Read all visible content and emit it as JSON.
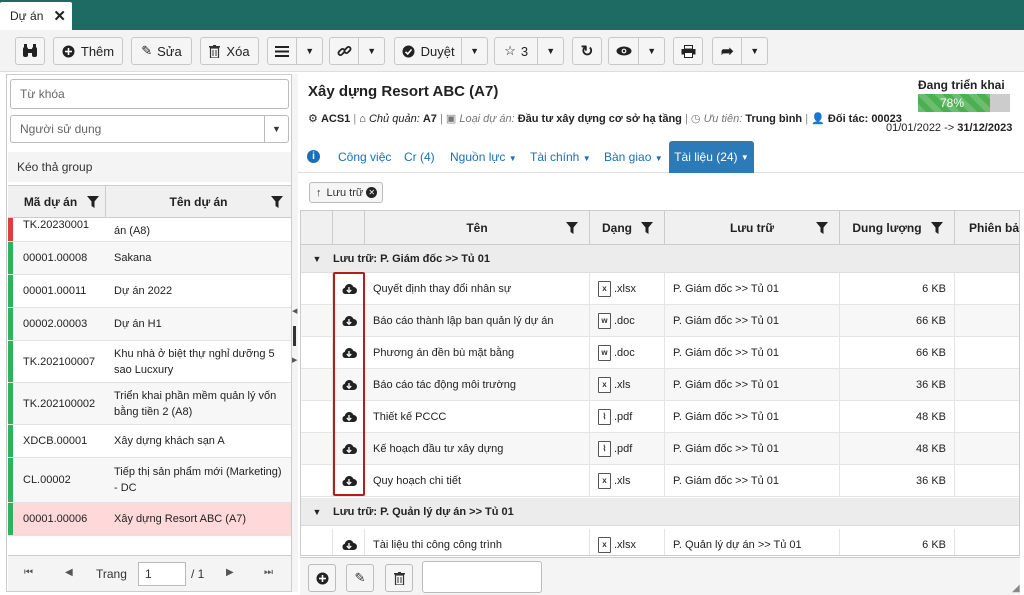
{
  "tab": {
    "label": "Dự án",
    "close": "✕"
  },
  "toolbar": {
    "add_label": "Thêm",
    "edit_label": "Sửa",
    "delete_label": "Xóa",
    "approve_label": "Duyệt",
    "star_count": "3"
  },
  "left": {
    "keyword_placeholder": "Từ khóa",
    "user_placeholder": "Người sử dụng",
    "group_hint": "Kéo thả group",
    "col_code": "Mã dự án",
    "col_name": "Tên dự án",
    "rows": [
      {
        "code": "TK.20230001",
        "name": "án (A8)",
        "status_color": "#e03c3c"
      },
      {
        "code": "00001.00008",
        "name": "Sakana",
        "status_color": "#2db35e"
      },
      {
        "code": "00001.00011",
        "name": "Dự án 2022",
        "status_color": "#2db35e"
      },
      {
        "code": "00002.00003",
        "name": "Dự án H1",
        "status_color": "#2db35e"
      },
      {
        "code": "TK.202100007",
        "name": "Khu nhà ở biệt thự nghỉ dưỡng 5 sao Lucxury",
        "status_color": "#2db35e"
      },
      {
        "code": "TK.202100002",
        "name": "Triển khai phần mềm quản lý vốn bằng tiền 2 (A8)",
        "status_color": "#2db35e"
      },
      {
        "code": "XDCB.00001",
        "name": "Xây dựng khách sạn A",
        "status_color": "#2db35e"
      },
      {
        "code": "CL.00002",
        "name": "Tiếp thị sản phẩm mới (Marketing) - DC",
        "status_color": "#2db35e"
      },
      {
        "code": "00001.00006",
        "name": "Xây dựng Resort ABC (A7)",
        "status_color": "#2db35e"
      }
    ],
    "pager_label": "Trang",
    "page_value": "1",
    "page_total": "/ 1"
  },
  "project": {
    "title": "Xây dựng Resort ABC (A7)",
    "status": "Đang triển khai",
    "progress_text": "78%",
    "progress": 0.78,
    "code": "ACS1",
    "owner_label": "Chủ quản:",
    "owner": "A7",
    "type_label": "Loại dự án:",
    "type": "Đầu tư xây dựng cơ sở hạ tầng",
    "priority_label": "Ưu tiên:",
    "priority": "Trung bình",
    "partner_label": "Đối tác:",
    "partner": "00023",
    "date_start": "01/01/2022",
    "date_arrow": "->",
    "date_end": "31/12/2023"
  },
  "subtabs": {
    "work": "Công việc",
    "cr": "Cr (4)",
    "resource": "Nguồn lực",
    "finance": "Tài chính",
    "handover": "Bàn giao",
    "docs": "Tài liệu (24)"
  },
  "filter_chip": "Lưu trữ",
  "docs": {
    "col_name": "Tên",
    "col_type": "Dạng",
    "col_storage": "Lưu trữ",
    "col_size": "Dung lượng",
    "col_version": "Phiên bản",
    "group1": "Lưu trữ: P. Giám đốc >> Tủ 01",
    "group2": "Lưu trữ: P. Quản lý dự án >> Tủ 01",
    "rows": [
      {
        "name": "Quyết định thay đổi nhân sự",
        "ext": ".xlsx",
        "kind": "x",
        "storage": "P. Giám đốc >> Tủ 01",
        "size": "6 KB"
      },
      {
        "name": "Báo cáo thành lập ban quản lý dự án",
        "ext": ".doc",
        "kind": "w",
        "storage": "P. Giám đốc >> Tủ 01",
        "size": "66 KB"
      },
      {
        "name": "Phương án đền bù mặt bằng",
        "ext": ".doc",
        "kind": "w",
        "storage": "P. Giám đốc >> Tủ 01",
        "size": "66 KB"
      },
      {
        "name": "Báo cáo tác động môi trường",
        "ext": ".xls",
        "kind": "x",
        "storage": "P. Giám đốc >> Tủ 01",
        "size": "36 KB"
      },
      {
        "name": "Thiết kế PCCC",
        "ext": ".pdf",
        "kind": "p",
        "storage": "P. Giám đốc >> Tủ 01",
        "size": "48 KB"
      },
      {
        "name": "Kế hoạch đầu tư xây dựng",
        "ext": ".pdf",
        "kind": "p",
        "storage": "P. Giám đốc >> Tủ 01",
        "size": "48 KB"
      },
      {
        "name": "Quy hoạch chi tiết",
        "ext": ".xls",
        "kind": "x",
        "storage": "P. Giám đốc >> Tủ 01",
        "size": "36 KB"
      }
    ],
    "row8": {
      "name": "Tài liệu thi công công trình",
      "ext": ".xlsx",
      "storage": "P. Quản lý dự án >> Tủ 01",
      "size": "6 KB"
    }
  }
}
